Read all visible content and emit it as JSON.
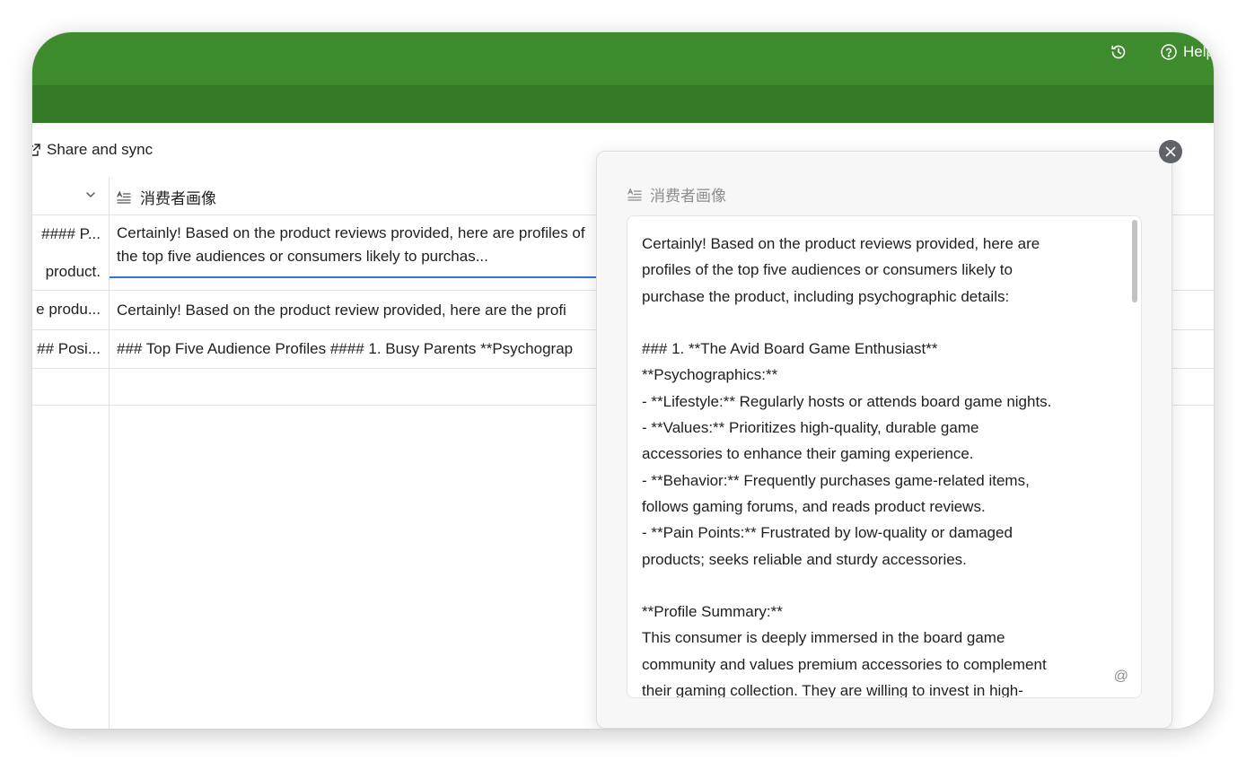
{
  "header": {
    "help_label": "Help",
    "history_icon": "history-icon",
    "help_icon": "help-circle-icon",
    "top_color": "#3d8b2c",
    "bottom_color": "#357a26"
  },
  "toolbar": {
    "share_label": "Share and sync",
    "share_icon": "external-share-icon"
  },
  "grid": {
    "column2_header": "消费者画像",
    "rows": [
      {
        "col1": "#### P...",
        "col2": "Certainly! Based on the product reviews provided, here are profiles of the top five audiences or consumers likely to purchas..."
      },
      {
        "col1": "product.",
        "col2": ""
      },
      {
        "col1": "e produ...",
        "col2": "Certainly! Based on the product review provided, here are the profi"
      },
      {
        "col1": "## Posi...",
        "col2": "### Top Five Audience Profiles #### 1. Busy Parents **Psychograp"
      },
      {
        "col1": "",
        "col2": ""
      }
    ]
  },
  "panel": {
    "title": "消费者画像",
    "content": "Certainly! Based on the product reviews provided, here are\nprofiles of the top five audiences or consumers likely to\npurchase the product, including psychographic details:\n\n### 1. **The Avid Board Game Enthusiast**\n**Psychographics:**\n- **Lifestyle:** Regularly hosts or attends board game nights.\n- **Values:** Prioritizes high-quality, durable game\naccessories to enhance their gaming experience.\n- **Behavior:** Frequently purchases game-related items,\nfollows gaming forums, and reads product reviews.\n- **Pain Points:** Frustrated by low-quality or damaged\nproducts; seeks reliable and sturdy accessories.\n\n**Profile Summary:**\nThis consumer is deeply immersed in the board game\ncommunity and values premium accessories to complement\ntheir gaming collection. They are willing to invest in high-",
    "mention_symbol": "@",
    "close_icon": "close-icon"
  }
}
